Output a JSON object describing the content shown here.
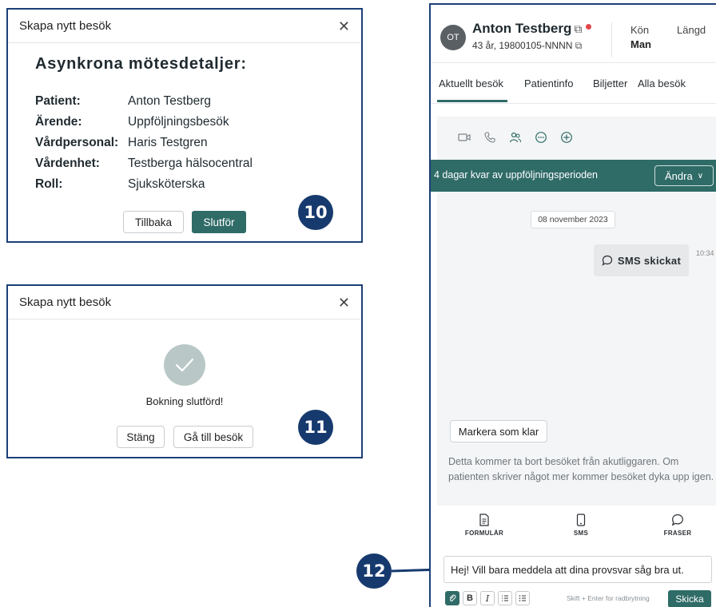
{
  "dialog_confirm": {
    "title": "Skapa nytt besök",
    "close_icon": "close-icon",
    "heading": "Asynkrona mötesdetaljer:",
    "details": [
      {
        "label": "Patient:",
        "value": "Anton Testberg"
      },
      {
        "label": "Ärende:",
        "value": "Uppföljningsbesök"
      },
      {
        "label": "Vårdpersonal:",
        "value": "Haris Testgren"
      },
      {
        "label": "Vårdenhet:",
        "value": "Testberga hälsocentral"
      },
      {
        "label": "Roll:",
        "value": "Sjuksköterska"
      }
    ],
    "back_label": "Tillbaka",
    "finish_label": "Slutför"
  },
  "dialog_done": {
    "title": "Skapa nytt besök",
    "message": "Bokning slutförd!",
    "close_label": "Stäng",
    "goto_label": "Gå till besök"
  },
  "callouts": [
    "10",
    "11",
    "12"
  ],
  "patient": {
    "initials": "OT",
    "name": "Anton Testberg",
    "meta": "43 år, 19800105-NNNN",
    "columns": [
      {
        "label": "Kön",
        "value": "Man"
      },
      {
        "label": "Längd",
        "value": ""
      }
    ]
  },
  "tabs": [
    "Aktuellt besök",
    "Patientinfo",
    "Biljetter",
    "Alla besök"
  ],
  "active_tab": "Aktuellt besök",
  "toolbar_icons": [
    "video-icon",
    "phone-icon",
    "people-icon",
    "chat-bubble-icon",
    "add-circle-icon"
  ],
  "banner": {
    "text": "4 dagar kvar av uppföljningsperioden",
    "button": "Ändra"
  },
  "thread": {
    "date": "08 november 2023",
    "bubble": "SMS skickat",
    "time": "10:34"
  },
  "mark_done": {
    "button": "Markera som klar",
    "info": "Detta kommer ta bort besöket från akutliggaren. Om patienten skriver något mer kommer besöket dyka upp igen."
  },
  "actions": [
    {
      "icon": "document-icon",
      "label": "FORMULÄR"
    },
    {
      "icon": "phone-device-icon",
      "label": "SMS"
    },
    {
      "icon": "speech-bubble-icon",
      "label": "FRASER"
    }
  ],
  "composer": {
    "text": "Hej! Vill bara meddela att dina provsvar såg bra ut.",
    "hint": "Skift + Enter for radbrytning",
    "send_label": "Skicka",
    "format_buttons": [
      "B",
      "I"
    ]
  },
  "colors": {
    "accent": "#2f6b67",
    "callout": "#173a6e",
    "status_dot": "#e0464a"
  }
}
